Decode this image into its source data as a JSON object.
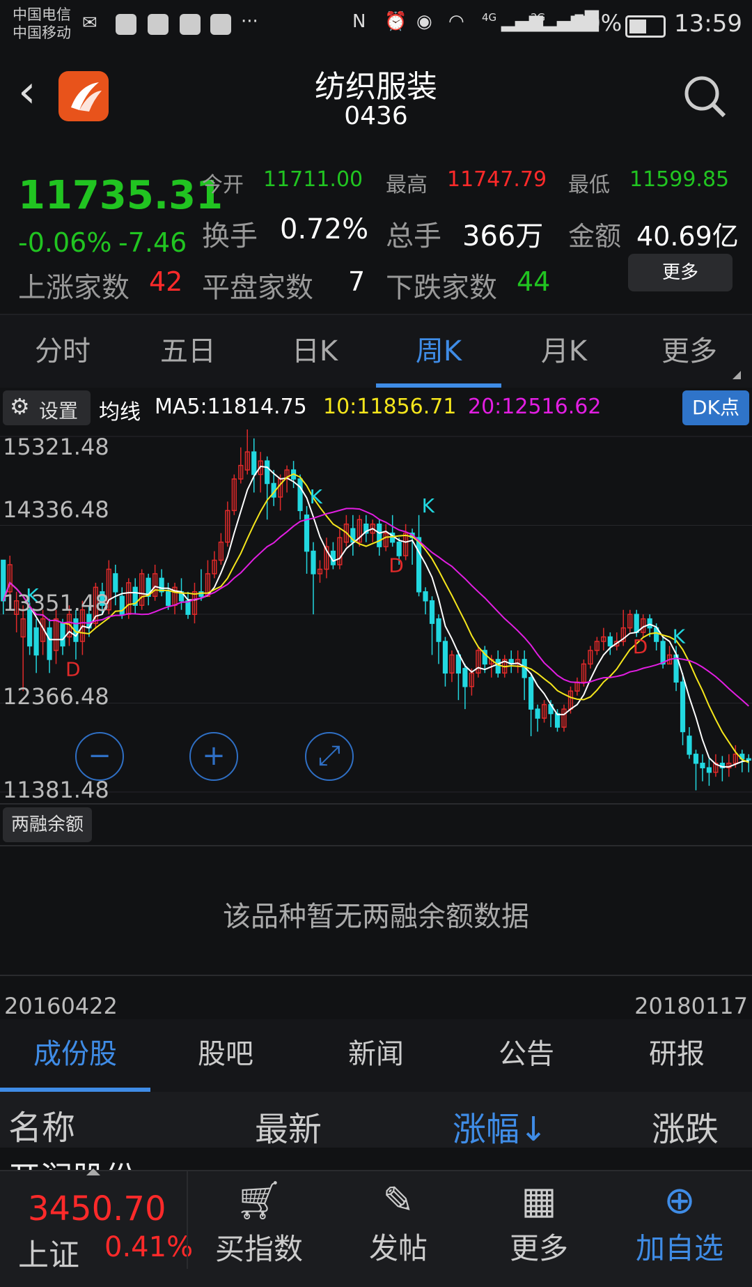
{
  "status_bar": {
    "carrier1": "中国电信",
    "carrier2": "中国移动",
    "network1": "4G",
    "network2": "2G",
    "battery": "50%",
    "time": "13:59"
  },
  "header": {
    "title": "纺织服装",
    "code": "0436"
  },
  "quote": {
    "price": "11735.31",
    "change_pct": "-0.06%",
    "change_abs": "-7.46",
    "open_label": "今开",
    "open": "11711.00",
    "high_label": "最高",
    "high": "11747.79",
    "low_label": "最低",
    "low": "11599.85",
    "turnover_label": "换手",
    "turnover": "0.72%",
    "volume_label": "总手",
    "volume": "366万",
    "amount_label": "金额",
    "amount": "40.69亿",
    "up_label": "上涨家数",
    "up": "42",
    "flat_label": "平盘家数",
    "flat": "7",
    "down_label": "下跌家数",
    "down": "44",
    "more": "更多"
  },
  "period_tabs": [
    "分时",
    "五日",
    "日K",
    "周K",
    "月K",
    "更多"
  ],
  "active_period": 3,
  "chart_toolbar": {
    "settings": "设置",
    "ma_label": "均线",
    "ma5": "MA5:11814.75",
    "ma10": "10:11856.71",
    "ma20": "20:12516.62",
    "dk": "DK点"
  },
  "chart_data": {
    "type": "candlestick",
    "price_ticks": [
      "15321.48",
      "14336.48",
      "13351.48",
      "12366.48",
      "11381.48"
    ],
    "ylim": [
      11381.48,
      15321.48
    ],
    "start_date": "20160422",
    "end_date": "20180117",
    "markers": [
      "K",
      "D",
      "K",
      "D",
      "K",
      "D",
      "K"
    ],
    "ma_colors": {
      "ma5": "#ffffff",
      "ma10": "#f5e61c",
      "ma20": "#e21ee2"
    },
    "up_color": "#e02a2a",
    "down_color": "#22d8e0",
    "candles": [
      [
        13950,
        13500,
        13700,
        13350
      ],
      [
        13600,
        13900,
        14000,
        13500
      ],
      [
        13350,
        13500,
        13600,
        13150
      ],
      [
        13100,
        13300,
        13450,
        12500
      ],
      [
        13400,
        13000,
        13480,
        12900
      ],
      [
        13200,
        12900,
        13300,
        12700
      ],
      [
        13050,
        13300,
        13400,
        12900
      ],
      [
        13200,
        12850,
        13300,
        12700
      ],
      [
        12950,
        13300,
        13400,
        12800
      ],
      [
        13250,
        13000,
        13300,
        12900
      ],
      [
        13100,
        13350,
        13450,
        13000
      ],
      [
        13300,
        13050,
        13400,
        12850
      ],
      [
        13050,
        13400,
        13500,
        12900
      ],
      [
        13350,
        13200,
        13450,
        13100
      ],
      [
        13250,
        13650,
        13700,
        13200
      ],
      [
        13600,
        13450,
        13700,
        13350
      ],
      [
        13400,
        13850,
        13950,
        13350
      ],
      [
        13800,
        13600,
        13900,
        13450
      ],
      [
        13550,
        13350,
        13650,
        13300
      ],
      [
        13350,
        13700,
        13750,
        13300
      ],
      [
        13650,
        13450,
        13750,
        13350
      ],
      [
        13450,
        13800,
        13850,
        13400
      ],
      [
        13750,
        13550,
        13800,
        13450
      ],
      [
        13550,
        13800,
        13900,
        13500
      ],
      [
        13750,
        13600,
        13850,
        13550
      ],
      [
        13600,
        13450,
        13700,
        13400
      ],
      [
        13450,
        13650,
        13700,
        13350
      ],
      [
        13600,
        13500,
        13750,
        13400
      ],
      [
        13500,
        13350,
        13600,
        13300
      ],
      [
        13350,
        13600,
        13700,
        13250
      ],
      [
        13600,
        13550,
        13850,
        13500
      ],
      [
        13550,
        13800,
        13950,
        13550
      ],
      [
        13800,
        13950,
        14050,
        13750
      ],
      [
        13950,
        14150,
        14250,
        13900
      ],
      [
        14150,
        14500,
        14600,
        14100
      ],
      [
        14500,
        14850,
        14900,
        14450
      ],
      [
        14850,
        15000,
        15200,
        14800
      ],
      [
        14950,
        15150,
        15450,
        14900
      ],
      [
        15150,
        14900,
        15300,
        14700
      ],
      [
        14900,
        15050,
        15150,
        14700
      ],
      [
        15050,
        14800,
        15100,
        14400
      ],
      [
        14800,
        14650,
        14950,
        14550
      ],
      [
        14650,
        14850,
        14900,
        14500
      ],
      [
        14850,
        14950,
        15000,
        14700
      ],
      [
        14950,
        14850,
        15050,
        14750
      ],
      [
        14850,
        14500,
        14900,
        14400
      ],
      [
        14450,
        14050,
        14550,
        13800
      ],
      [
        14050,
        13800,
        14150,
        13350
      ],
      [
        13800,
        13850,
        13950,
        13700
      ],
      [
        13850,
        14100,
        14200,
        13750
      ],
      [
        14050,
        13900,
        14150,
        13850
      ],
      [
        13900,
        14200,
        14300,
        13850
      ],
      [
        14150,
        14350,
        14450,
        14100
      ],
      [
        14300,
        14150,
        14450,
        14000
      ],
      [
        14150,
        14400,
        14450,
        14100
      ],
      [
        14350,
        14250,
        14450,
        14150
      ],
      [
        14250,
        14350,
        14400,
        14150
      ],
      [
        14350,
        14100,
        14400,
        14000
      ],
      [
        14100,
        14250,
        14350,
        14050
      ],
      [
        14250,
        14150,
        14450,
        14100
      ],
      [
        14150,
        14000,
        14200,
        13900
      ],
      [
        14000,
        14250,
        14350,
        13950
      ],
      [
        14250,
        14200,
        14300,
        13900
      ],
      [
        14200,
        13600,
        14450,
        13550
      ],
      [
        13600,
        13500,
        13650,
        13350
      ],
      [
        13500,
        13250,
        13550,
        12900
      ],
      [
        13300,
        13050,
        13350,
        12800
      ],
      [
        13050,
        12700,
        13100,
        12550
      ],
      [
        12700,
        12900,
        12950,
        12600
      ],
      [
        12900,
        12700,
        12950,
        12400
      ],
      [
        12750,
        12550,
        12800,
        12300
      ],
      [
        12550,
        12700,
        12750,
        12450
      ],
      [
        12700,
        12950,
        13000,
        12650
      ],
      [
        12950,
        12800,
        13000,
        12700
      ],
      [
        12800,
        12850,
        12900,
        12650
      ],
      [
        12850,
        12700,
        12950,
        12650
      ],
      [
        12700,
        12850,
        12900,
        12650
      ],
      [
        12850,
        12800,
        12950,
        12700
      ],
      [
        12800,
        12850,
        12950,
        12700
      ],
      [
        12850,
        12650,
        12950,
        12400
      ],
      [
        12650,
        12300,
        12700,
        12000
      ],
      [
        12300,
        12200,
        12350,
        12050
      ],
      [
        12200,
        12350,
        12400,
        12150
      ],
      [
        12350,
        12250,
        12400,
        12100
      ],
      [
        12250,
        12100,
        12300,
        12050
      ],
      [
        12100,
        12300,
        12350,
        12050
      ],
      [
        12300,
        12500,
        12550,
        12250
      ],
      [
        12500,
        12600,
        12650,
        12450
      ],
      [
        12600,
        12800,
        12850,
        12550
      ],
      [
        12800,
        12950,
        13000,
        12750
      ],
      [
        12950,
        13050,
        13100,
        12900
      ],
      [
        13050,
        13100,
        13200,
        12950
      ],
      [
        13100,
        13000,
        13150,
        12900
      ],
      [
        13000,
        13050,
        13150,
        12950
      ],
      [
        13050,
        13200,
        13400,
        13000
      ],
      [
        13200,
        13350,
        13400,
        13150
      ],
      [
        13350,
        13150,
        13400,
        13100
      ],
      [
        13150,
        13300,
        13350,
        13100
      ],
      [
        13300,
        13200,
        13350,
        13100
      ],
      [
        13200,
        13050,
        13250,
        12950
      ],
      [
        13050,
        12800,
        13100,
        12750
      ],
      [
        12800,
        12900,
        13000,
        12800
      ],
      [
        12900,
        12600,
        13000,
        12500
      ],
      [
        12600,
        12050,
        12700,
        11900
      ],
      [
        12000,
        11800,
        12100,
        11750
      ],
      [
        11800,
        11700,
        11850,
        11400
      ],
      [
        11700,
        11650,
        11800,
        11500
      ],
      [
        11650,
        11600,
        11750,
        11450
      ],
      [
        11600,
        11700,
        11800,
        11550
      ],
      [
        11700,
        11650,
        11780,
        11500
      ],
      [
        11650,
        11700,
        11800,
        11550
      ],
      [
        11700,
        11800,
        11900,
        11650
      ],
      [
        11800,
        11750,
        11850,
        11600
      ],
      [
        11750,
        11735,
        11800,
        11600
      ]
    ]
  },
  "chart_controls": {
    "zoom_out": "−",
    "zoom_in": "+",
    "expand": "⤢"
  },
  "margin": {
    "button": "两融余额",
    "empty": "该品种暂无两融余额数据"
  },
  "sub_tabs": [
    "成份股",
    "股吧",
    "新闻",
    "公告",
    "研报"
  ],
  "active_sub_tab": 0,
  "table_header": {
    "name": "名称",
    "latest": "最新",
    "change_pct": "涨幅↓",
    "change": "涨跌"
  },
  "partial_row": "开润股份",
  "bottom_bar": {
    "index_value": "3450.70",
    "index_name": "上证",
    "index_change": "0.41%",
    "buy_index": "买指数",
    "post": "发帖",
    "more": "更多",
    "add_watch": "加自选"
  }
}
